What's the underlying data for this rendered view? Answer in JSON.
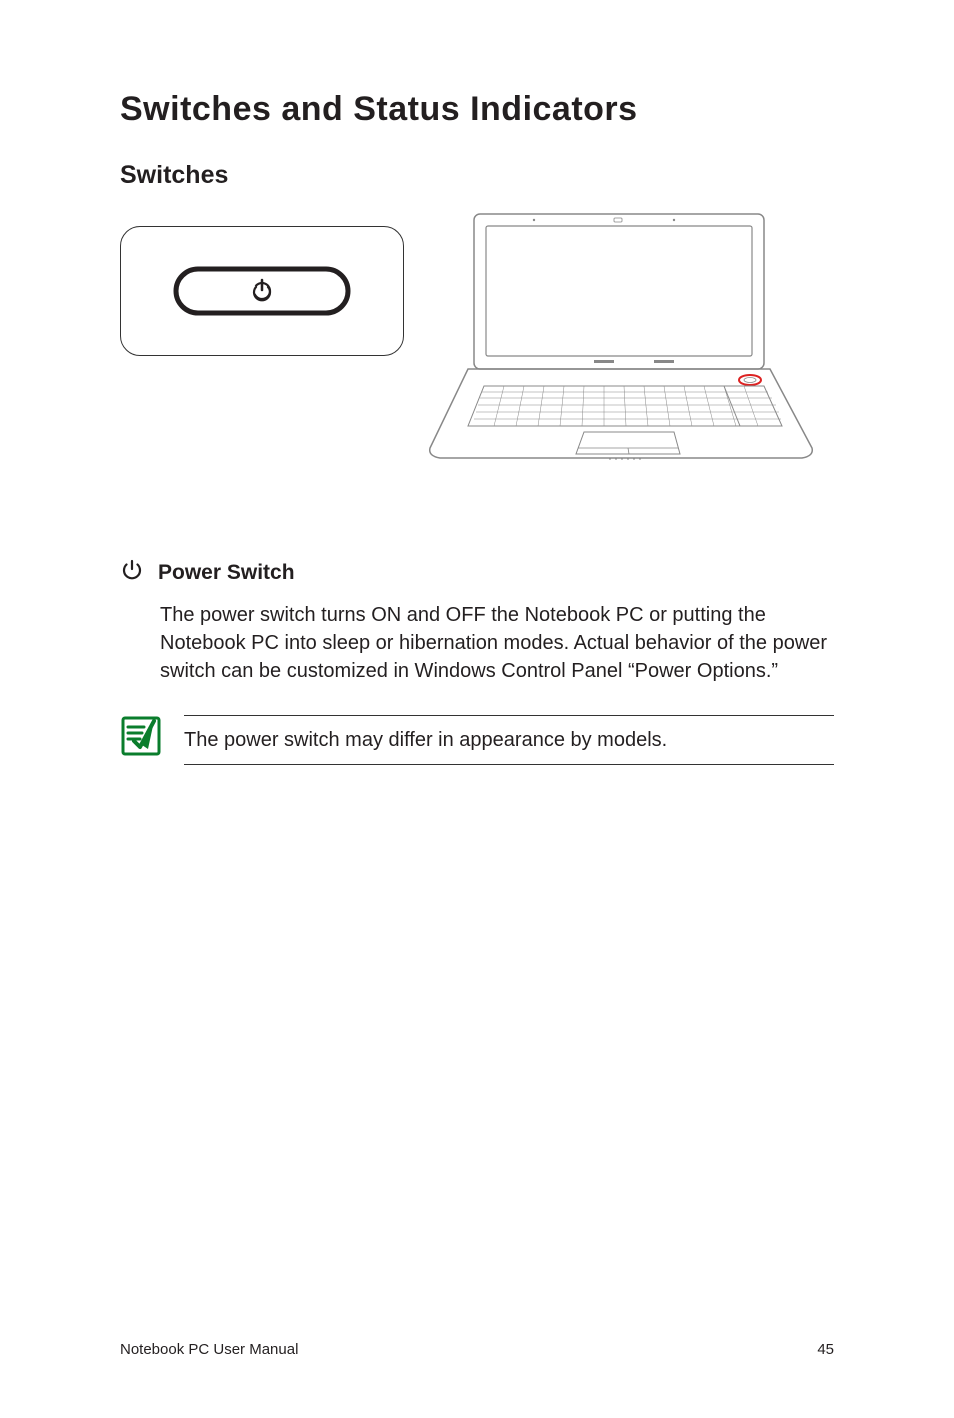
{
  "title": "Switches and Status Indicators",
  "section1": {
    "heading": "Switches"
  },
  "power_switch": {
    "heading": "Power Switch",
    "body": "The power switch turns ON and OFF the Notebook PC or putting the Notebook PC into sleep or hibernation modes. Actual behavior of the power switch can be customized in Windows Control Panel “Power Options.”",
    "note": "The power switch may differ in appearance by models."
  },
  "footer": {
    "left": "Notebook PC User Manual",
    "page": "45"
  }
}
